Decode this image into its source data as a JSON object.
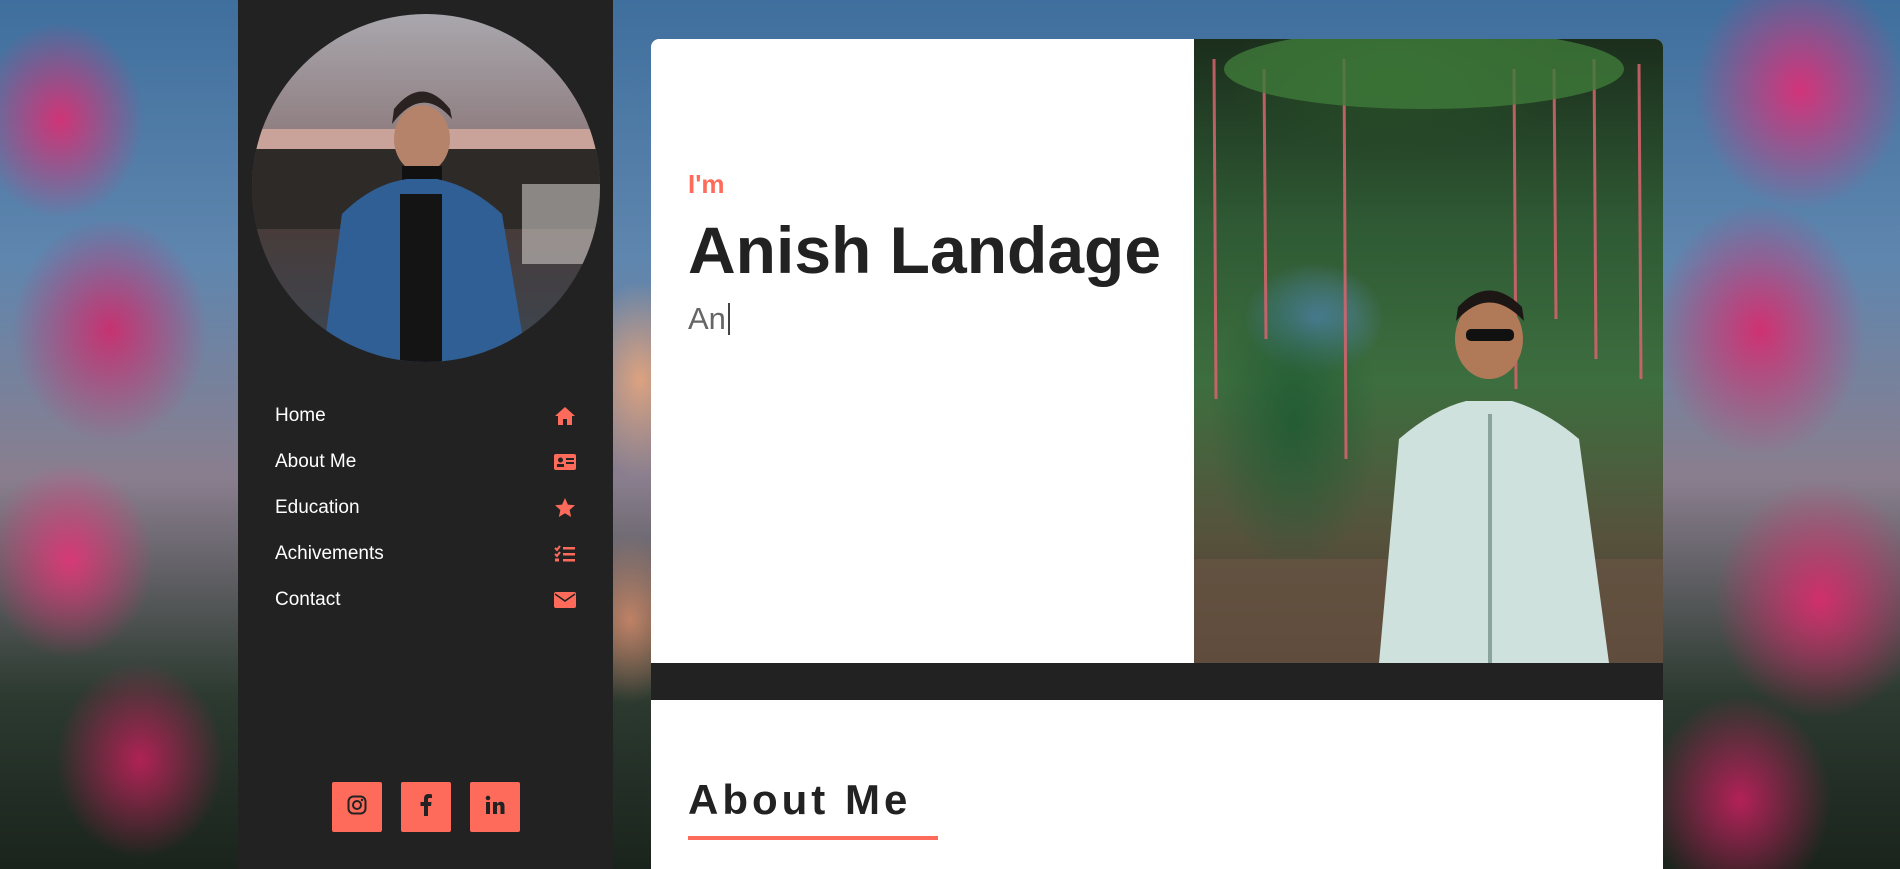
{
  "colors": {
    "accent": "#ff6b5a",
    "sidebar_bg": "#222222",
    "text_dark": "#222222",
    "text_muted": "#666666"
  },
  "sidebar": {
    "profile_image": "profile-photo",
    "nav": [
      {
        "label": "Home",
        "icon": "home-icon"
      },
      {
        "label": "About Me",
        "icon": "id-card-icon"
      },
      {
        "label": "Education",
        "icon": "star-icon"
      },
      {
        "label": "Achivements",
        "icon": "tasks-icon"
      },
      {
        "label": "Contact",
        "icon": "envelope-icon"
      }
    ],
    "socials": [
      {
        "name": "instagram-icon"
      },
      {
        "name": "facebook-icon"
      },
      {
        "name": "linkedin-icon"
      }
    ]
  },
  "hero": {
    "intro": "I'm",
    "name": "Anish Landage",
    "typed_text": "An",
    "photo": "hero-photo"
  },
  "about": {
    "title": "About Me"
  }
}
